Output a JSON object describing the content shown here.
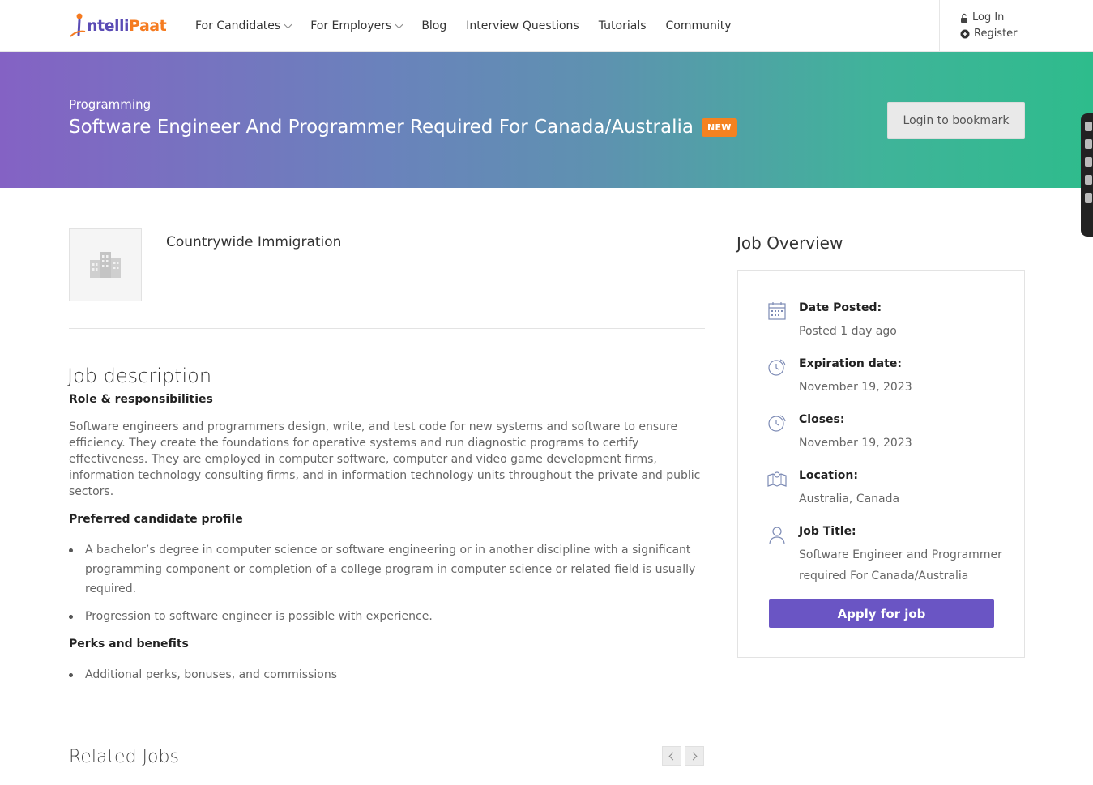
{
  "header": {
    "logo": {
      "part1": "ntelli",
      "part2": "Paat",
      "initial": "I"
    },
    "nav": [
      {
        "label": "For Candidates",
        "dropdown": true
      },
      {
        "label": "For Employers",
        "dropdown": true
      },
      {
        "label": "Blog",
        "dropdown": false
      },
      {
        "label": "Interview Questions",
        "dropdown": false
      },
      {
        "label": "Tutorials",
        "dropdown": false
      },
      {
        "label": "Community",
        "dropdown": false
      }
    ],
    "login_label": "Log In",
    "register_label": "Register"
  },
  "hero": {
    "category": "Programming",
    "title": "Software Engineer And Programmer Required For Canada/Australia",
    "badge": "NEW",
    "bookmark_label": "Login to bookmark"
  },
  "company": {
    "name": "Countrywide Immigration"
  },
  "description": {
    "title": "Job description",
    "role_heading": "Role & responsibilities",
    "role_text": "Software engineers and programmers design, write, and test code for new systems and software to ensure efficiency. They create the foundations for operative systems and run diagnostic programs to certify effectiveness. They are employed in computer software, computer and video game development firms, information technology consulting firms, and in information technology units throughout the private and public sectors.",
    "profile_heading": "Preferred candidate profile",
    "profile_items": [
      "A bachelor’s degree in computer science or software engineering or in another discipline with a significant programming component or completion of a college program in computer science or related field is usually required.",
      "Progression to software engineer is possible with experience."
    ],
    "perks_heading": "Perks and benefits",
    "perks_items": [
      "Additional perks, bonuses, and commissions"
    ]
  },
  "overview": {
    "title": "Job Overview",
    "items": [
      {
        "icon": "calendar-icon",
        "label": "Date Posted:",
        "value": "Posted 1 day ago"
      },
      {
        "icon": "clock-icon",
        "label": "Expiration date:",
        "value": "November 19, 2023"
      },
      {
        "icon": "clock-icon",
        "label": "Closes:",
        "value": "November 19, 2023"
      },
      {
        "icon": "map-pin-icon",
        "label": "Location:",
        "value": "Australia, Canada"
      },
      {
        "icon": "user-icon",
        "label": "Job Title:",
        "value": "Software Engineer and Programmer required For Canada/Australia"
      }
    ],
    "apply_label": "Apply for job"
  },
  "related": {
    "title": "Related Jobs"
  },
  "colors": {
    "brand_purple": "#5a4bb5",
    "brand_orange": "#f57b20",
    "apply_button": "#6a55c4",
    "badge_new": "#f58220"
  }
}
